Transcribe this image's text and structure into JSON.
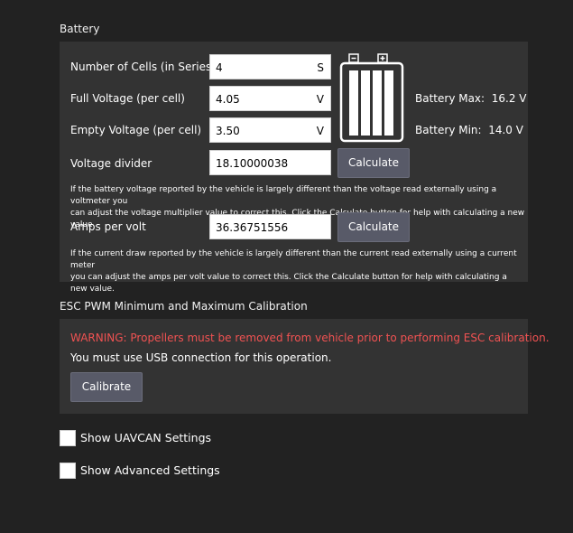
{
  "battery": {
    "section_title": "Battery",
    "cells_label": "Number of Cells (in Series)",
    "cells_value": "4",
    "cells_unit": "S",
    "full_label": "Full Voltage (per cell)",
    "full_value": "4.05",
    "full_unit": "V",
    "empty_label": "Empty Voltage (per cell)",
    "empty_value": "3.50",
    "empty_unit": "V",
    "max_label": "Battery Max:",
    "max_value": "16.2 V",
    "min_label": "Battery Min:",
    "min_value": "14.0 V",
    "divider_label": "Voltage divider",
    "divider_value": "18.10000038",
    "divider_button": "Calculate",
    "divider_help_line1": "If the battery voltage reported by the vehicle is largely different than the voltage read externally using a voltmeter you",
    "divider_help_line2": "can adjust the voltage multiplier value to correct this. Click the Calculate button for help with calculating a new value.",
    "amps_label": "Amps per volt",
    "amps_value": "36.36751556",
    "amps_button": "Calculate",
    "amps_help_line1": "If the current draw reported by the vehicle is largely different than the current read externally using a current meter",
    "amps_help_line2": "you can adjust the amps per volt value to correct this. Click the Calculate button for help with calculating a new value."
  },
  "esc": {
    "section_title": "ESC PWM Minimum and Maximum Calibration",
    "warning": "WARNING: Propellers must be removed from vehicle prior to performing ESC calibration.",
    "usb_note": "You must use USB connection for this operation.",
    "calibrate_button": "Calibrate"
  },
  "options": {
    "uavcan_label": "Show UAVCAN Settings",
    "advanced_label": "Show Advanced Settings"
  },
  "colors": {
    "background": "#222222",
    "panel": "#333333",
    "button": "#585a68",
    "warning": "#f05252"
  }
}
